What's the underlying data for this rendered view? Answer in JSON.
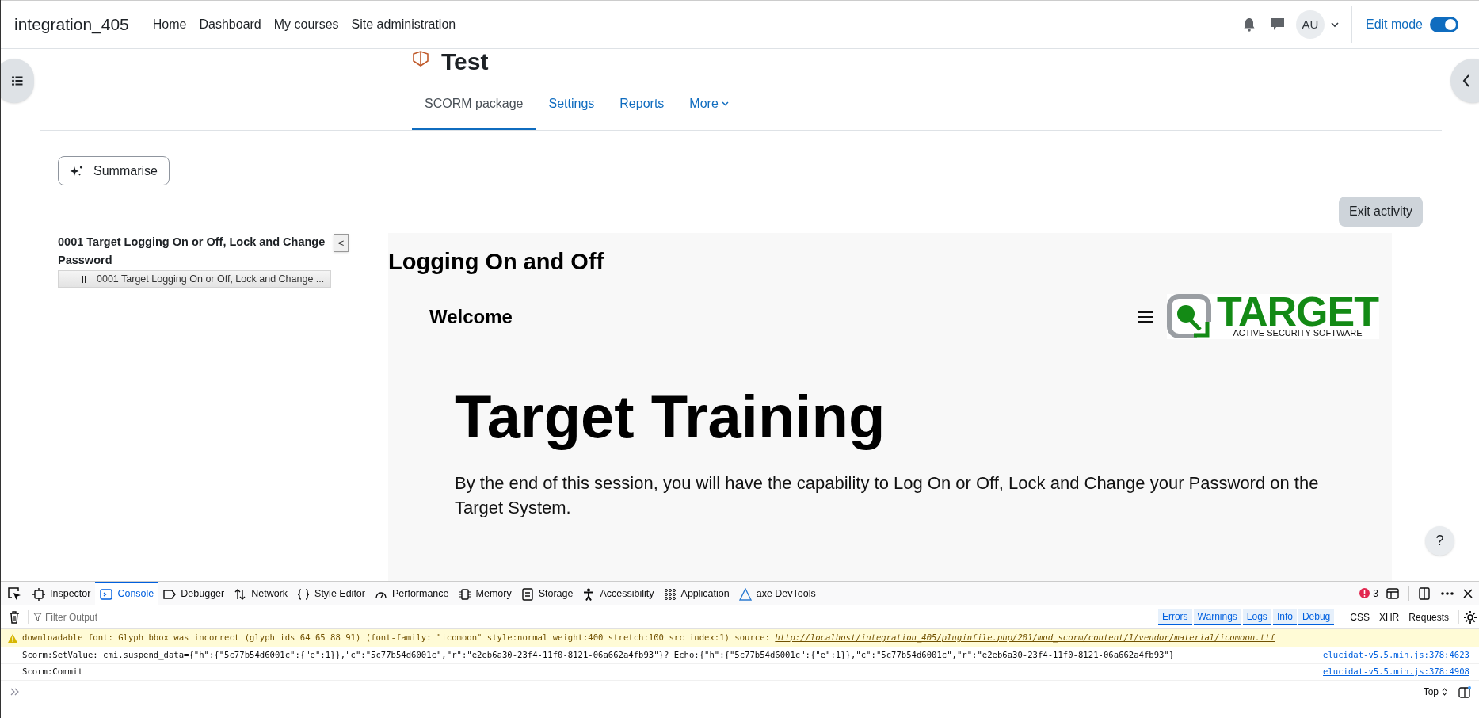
{
  "navbar": {
    "site_name": "integration_405",
    "links": [
      "Home",
      "Dashboard",
      "My courses",
      "Site administration"
    ],
    "avatar": "AU",
    "edit_mode": {
      "label": "Edit mode",
      "on": true
    }
  },
  "page": {
    "title": "Test",
    "tabs": [
      {
        "label": "SCORM package",
        "selected": true
      },
      {
        "label": "Settings",
        "selected": false
      },
      {
        "label": "Reports",
        "selected": false
      },
      {
        "label": "More",
        "selected": false,
        "kind": "dropdown"
      }
    ],
    "summarise_button": "Summarise",
    "exit_button": "Exit activity"
  },
  "toc": {
    "title": "0001 Target Logging On or Off, Lock and Change Password",
    "collapse_button": "<",
    "items": [
      {
        "label": "0001 Target Logging On or Off, Lock and Change ..."
      }
    ]
  },
  "content": {
    "heading": "Logging On and Off",
    "welcome": "Welcome",
    "logo": {
      "wordmark": "TARGET",
      "tagline": "ACTIVE SECURITY SOFTWARE"
    },
    "title": "Target Training",
    "intro": "By the end of this session, you will have the capability to Log On or Off, Lock and Change your Password on the Target System."
  },
  "help_button": "?",
  "devtools": {
    "tabs": [
      {
        "label": "Inspector",
        "selected": false
      },
      {
        "label": "Console",
        "selected": true
      },
      {
        "label": "Debugger",
        "selected": false
      },
      {
        "label": "Network",
        "selected": false
      },
      {
        "label": "Style Editor",
        "selected": false
      },
      {
        "label": "Performance",
        "selected": false
      },
      {
        "label": "Memory",
        "selected": false
      },
      {
        "label": "Storage",
        "selected": false
      },
      {
        "label": "Accessibility",
        "selected": false
      },
      {
        "label": "Application",
        "selected": false
      },
      {
        "label": "axe DevTools",
        "selected": false
      }
    ],
    "error_count": "3",
    "filter_placeholder": "Filter Output",
    "filters": [
      {
        "label": "Errors",
        "selected": true
      },
      {
        "label": "Warnings",
        "selected": true
      },
      {
        "label": "Logs",
        "selected": true
      },
      {
        "label": "Info",
        "selected": true
      },
      {
        "label": "Debug",
        "selected": true
      },
      {
        "label": "CSS",
        "selected": false
      },
      {
        "label": "XHR",
        "selected": false
      },
      {
        "label": "Requests",
        "selected": false
      }
    ],
    "messages": [
      {
        "kind": "warning",
        "text": "downloadable font: Glyph bbox was incorrect (glyph ids 64 65 88 91) (font-family: \"icomoon\" style:normal weight:400 stretch:100 src index:1) source: ",
        "link": "http://localhost/integration_405/pluginfile.php/201/mod_scorm/content/1/vendor/material/icomoon.ttf"
      },
      {
        "kind": "log",
        "text": "Scorm:SetValue: cmi.suspend_data={\"h\":{\"5c77b54d6001c\":{\"e\":1}},\"c\":\"5c77b54d6001c\",\"r\":\"e2eb6a30-23f4-11f0-8121-06a662a4fb93\"}? Echo:{\"h\":{\"5c77b54d6001c\":{\"e\":1}},\"c\":\"5c77b54d6001c\",\"r\":\"e2eb6a30-23f4-11f0-8121-06a662a4fb93\"}",
        "source": "elucidat-v5.5.min.js:378:4623"
      },
      {
        "kind": "log",
        "text": "Scorm:Commit",
        "source": "elucidat-v5.5.min.js:378:4908"
      }
    ],
    "context": "Top"
  }
}
